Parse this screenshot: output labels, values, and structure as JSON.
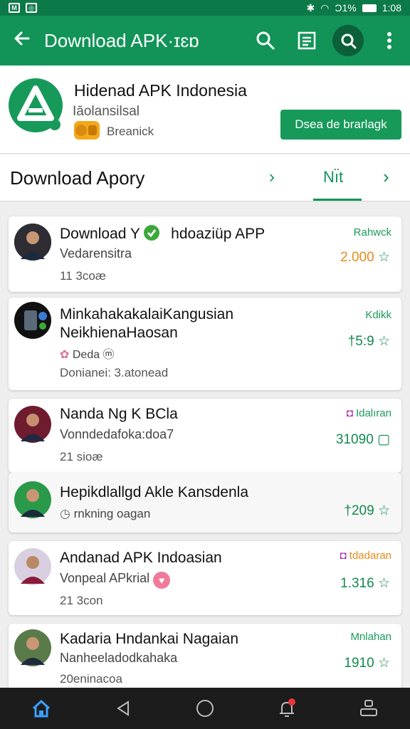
{
  "status_bar": {
    "left_icons": [
      "M",
      "◎"
    ],
    "right_text": "Ͻ1%",
    "time": "1:08"
  },
  "app_bar": {
    "back_icon": "arrow-back-icon",
    "title": "Download APK·ɪɛɒ"
  },
  "header": {
    "title": "Hidenad APK Indonesia",
    "subtitle": "Iāolansilsal",
    "badge_text": "Breanick",
    "button": "Dsea de brarlagk"
  },
  "tabs": {
    "title": "Download Apory",
    "arrow_label": "›",
    "next_label": "Nı̈t"
  },
  "list": [
    {
      "name": "Download Y",
      "name2": "hdoaziüp APP",
      "sub": "Vedarensitra",
      "meta": "11 3coæ",
      "tag": "Rahwck",
      "num": "2.000",
      "tag_color": "#1a9a5a",
      "num_color": "#e88a1a"
    },
    {
      "name": "MinkahakakalaiKangusian",
      "sub2": "NeikhienaHaosan",
      "sub": "Deda ⓜ",
      "meta": "Donianei: 3.atonead",
      "tag": "Kdikk",
      "num": "†5:9",
      "tag_color": "#1a9a5a",
      "num_color": "#128a4c"
    },
    {
      "name": "Nanda Ng K BCla",
      "sub": "Vonndedafoka:doa7",
      "meta": "21 sioæ",
      "tag": "Idalıran",
      "num": "31090",
      "tag_color": "#1a9a5a",
      "num_color": "#128a4c"
    },
    {
      "name": "Hepikdlallgd Akle Kansdenla",
      "sub": "rnkning oagan",
      "tag": "",
      "num": "†209",
      "tag_color": "#1a9a5a",
      "num_color": "#128a4c"
    },
    {
      "name": "Andanad APK Indoasian",
      "sub": "Vonpeal APkrial",
      "meta": "21 3con",
      "tag": "tdadaran",
      "num": "1.316",
      "tag_color": "#e88a1a",
      "num_color": "#128a4c"
    },
    {
      "name": "Kadaria Hndankai Nagaian",
      "sub": "Nanheeladodkahaka",
      "meta": "20eninacoa",
      "tag": "Mnlahan",
      "num": "1910",
      "tag_color": "#1a9a5a",
      "num_color": "#128a4c"
    }
  ],
  "colors": {
    "primary": "#129458",
    "accent_orange": "#f4a81c",
    "purple": "#b02bb8"
  }
}
